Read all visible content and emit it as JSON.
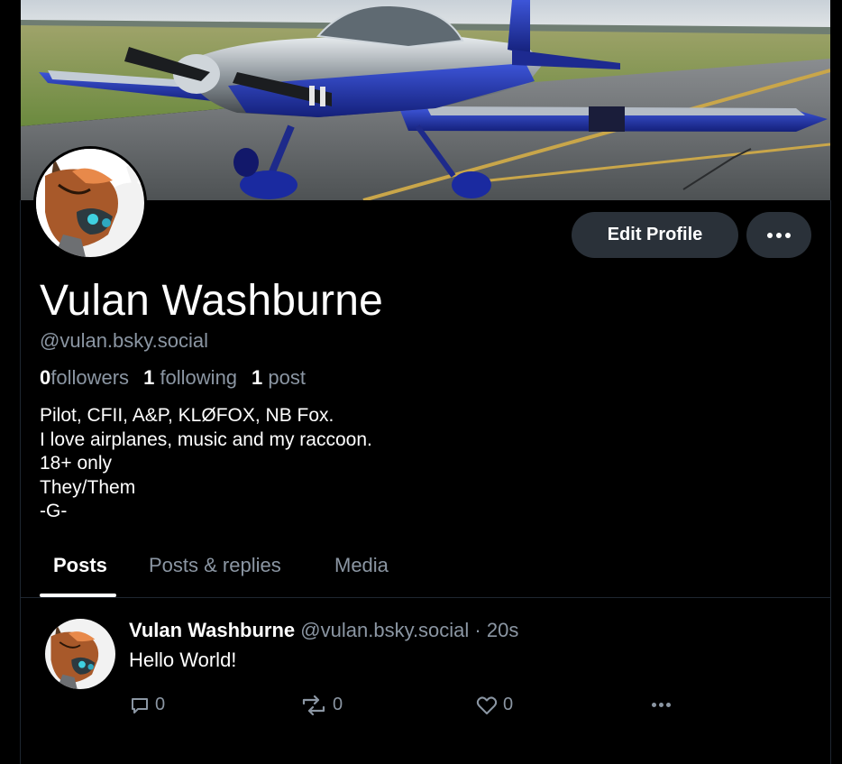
{
  "profile": {
    "banner_description": "banner-photo",
    "display_name": "Vulan Washburne",
    "handle": "@vulan.bsky.social",
    "stats": {
      "followers_count": "0",
      "followers_label": "followers",
      "following_count": "1",
      "following_label": "following",
      "posts_count": "1",
      "posts_label": "post"
    },
    "bio_lines": [
      "Pilot, CFII, A&P, KLØFOX, NB Fox.",
      "I love airplanes, music and my raccoon.",
      "18+ only",
      "They/Them",
      "-G-"
    ],
    "edit_label": "Edit Profile"
  },
  "tabs": [
    {
      "label": "Posts",
      "active": true
    },
    {
      "label": "Posts & replies",
      "active": false
    },
    {
      "label": "Media",
      "active": false
    }
  ],
  "post": {
    "author": "Vulan Washburne",
    "handle": "@vulan.bsky.social",
    "separator": "·",
    "time": "20s",
    "text": "Hello World!",
    "reply_count": "0",
    "repost_count": "0",
    "like_count": "0"
  },
  "colors": {
    "background": "#000000",
    "button_bg": "#2a3139",
    "muted_text": "#8b96a3",
    "divider": "#1e2630"
  },
  "icons": {
    "more": "more-horizontal-icon",
    "reply": "reply-bubble-icon",
    "repost": "repost-icon",
    "like": "heart-icon"
  }
}
